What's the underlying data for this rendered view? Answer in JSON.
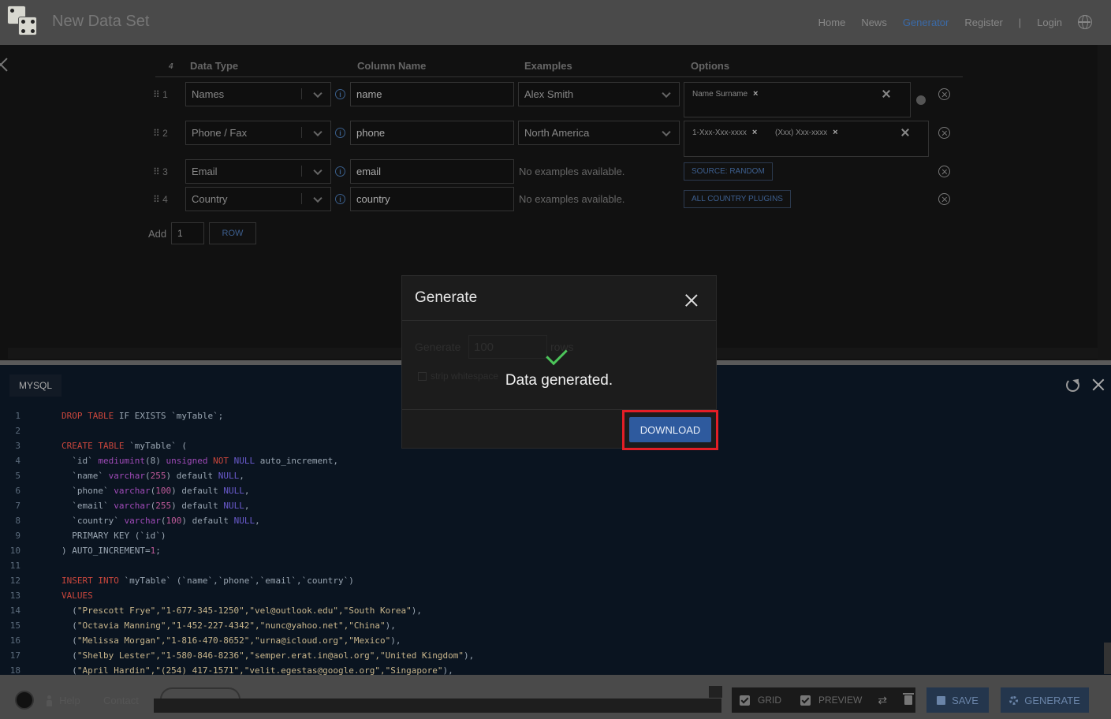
{
  "header": {
    "site_title": "New Data Set",
    "nav": {
      "home": "Home",
      "news": "News",
      "generator": "Generator",
      "register": "Register",
      "separator": "|",
      "login": "Login"
    }
  },
  "grid": {
    "columns": {
      "sort": "4",
      "data_type": "Data Type",
      "column_name": "Column Name",
      "examples": "Examples",
      "options": "Options"
    },
    "rows": [
      {
        "num": "⠿ 1",
        "data_type": "Names",
        "column_name": "name",
        "example": "Alex Smith",
        "tags": [
          "Name Surname"
        ]
      },
      {
        "num": "⠿ 2",
        "data_type": "Phone / Fax",
        "column_name": "phone",
        "example": "North America",
        "tags": [
          "1-Xxx-Xxx-xxxx",
          "(Xxx) Xxx-xxxx"
        ]
      },
      {
        "num": "⠿ 3",
        "data_type": "Email",
        "column_name": "email",
        "example_text": "No examples available.",
        "option_button": "SOURCE: RANDOM"
      },
      {
        "num": "⠿ 4",
        "data_type": "Country",
        "column_name": "country",
        "example_text": "No examples available.",
        "option_button": "ALL COUNTRY PLUGINS"
      }
    ],
    "add": {
      "label": "Add",
      "value": "1",
      "button": "ROW"
    }
  },
  "code_panel": {
    "tab": "MYSQL",
    "line_numbers": [
      "1",
      "2",
      "3",
      "4",
      "5",
      "6",
      "7",
      "8",
      "9",
      "10",
      "11",
      "12",
      "13",
      "14",
      "15",
      "16",
      "17",
      "18"
    ],
    "lines": [
      [
        [
          "kw",
          "DROP TABLE"
        ],
        [
          "p",
          " IF EXISTS `myTable`;"
        ]
      ],
      [],
      [
        [
          "kw",
          "CREATE TABLE"
        ],
        [
          "p",
          " `myTable` ("
        ]
      ],
      [
        [
          "p",
          "  `id` "
        ],
        [
          "ty",
          "mediumint"
        ],
        [
          "p",
          "(8) "
        ],
        [
          "ty",
          "unsigned"
        ],
        [
          "p",
          " "
        ],
        [
          "kw",
          "NOT"
        ],
        [
          "p",
          " "
        ],
        [
          "nl",
          "NULL"
        ],
        [
          "p",
          " auto_increment,"
        ]
      ],
      [
        [
          "p",
          "  `name` "
        ],
        [
          "ty",
          "varchar"
        ],
        [
          "p",
          "("
        ],
        [
          "num",
          "255"
        ],
        [
          "p",
          ") default "
        ],
        [
          "nl",
          "NULL"
        ],
        [
          "p",
          ","
        ]
      ],
      [
        [
          "p",
          "  `phone` "
        ],
        [
          "ty",
          "varchar"
        ],
        [
          "p",
          "("
        ],
        [
          "num",
          "100"
        ],
        [
          "p",
          ") default "
        ],
        [
          "nl",
          "NULL"
        ],
        [
          "p",
          ","
        ]
      ],
      [
        [
          "p",
          "  `email` "
        ],
        [
          "ty",
          "varchar"
        ],
        [
          "p",
          "("
        ],
        [
          "num",
          "255"
        ],
        [
          "p",
          ") default "
        ],
        [
          "nl",
          "NULL"
        ],
        [
          "p",
          ","
        ]
      ],
      [
        [
          "p",
          "  `country` "
        ],
        [
          "ty",
          "varchar"
        ],
        [
          "p",
          "("
        ],
        [
          "num",
          "100"
        ],
        [
          "p",
          ") default "
        ],
        [
          "nl",
          "NULL"
        ],
        [
          "p",
          ","
        ]
      ],
      [
        [
          "p",
          "  PRIMARY KEY (`id`)"
        ]
      ],
      [
        [
          "p",
          ") AUTO_INCREMENT="
        ],
        [
          "num",
          "1"
        ],
        [
          "p",
          ";"
        ]
      ],
      [],
      [
        [
          "kw",
          "INSERT INTO"
        ],
        [
          "p",
          " `myTable` (`name`,`phone`,`email`,`country`)"
        ]
      ],
      [
        [
          "kw",
          "VALUES"
        ]
      ],
      [
        [
          "p",
          "  ("
        ],
        [
          "str",
          "\"Prescott Frye\",\"1-677-345-1250\",\"vel@outlook.edu\",\"South Korea\""
        ],
        [
          "p",
          "),"
        ]
      ],
      [
        [
          "p",
          "  ("
        ],
        [
          "str",
          "\"Octavia Manning\",\"1-452-227-4342\",\"nunc@yahoo.net\",\"China\""
        ],
        [
          "p",
          "),"
        ]
      ],
      [
        [
          "p",
          "  ("
        ],
        [
          "str",
          "\"Melissa Morgan\",\"1-816-470-8652\",\"urna@icloud.org\",\"Mexico\""
        ],
        [
          "p",
          "),"
        ]
      ],
      [
        [
          "p",
          "  ("
        ],
        [
          "str",
          "\"Shelby Lester\",\"1-580-846-8236\",\"semper.erat.in@aol.org\",\"United Kingdom\""
        ],
        [
          "p",
          "),"
        ]
      ],
      [
        [
          "p",
          "  ("
        ],
        [
          "str",
          "\"April Hardin\",\"(254) 417-1571\",\"velit.egestas@google.org\",\"Singapore\""
        ],
        [
          "p",
          "),"
        ]
      ]
    ]
  },
  "footer": {
    "help": "Help",
    "contact": "Contact",
    "toolbar": {
      "grid": "GRID",
      "preview": "PREVIEW"
    },
    "save": "SAVE",
    "generate": "GENERATE"
  },
  "modal": {
    "title": "Generate",
    "generate_label": "Generate",
    "rows_value": "100",
    "rows_label": "rows",
    "strip_label": "strip whitespace",
    "message": "Data generated.",
    "download": "DOWNLOAD"
  },
  "colors": {
    "accent": "#2e5a9e",
    "highlight": "#e41e26",
    "success": "#4cc45a"
  }
}
